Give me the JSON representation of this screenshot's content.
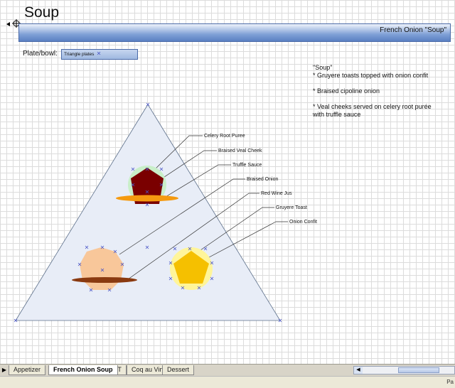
{
  "page": {
    "title": "Soup",
    "banner_title": "French Onion \"Soup\""
  },
  "plate": {
    "label": "Plate/bowl:",
    "value": "Triangle plates"
  },
  "notes": [
    "\"Soup\"",
    "* Gruyere toasts topped with onion confit",
    "",
    "* Braised cipoline onion",
    "",
    "* Veal cheeks served on celery root purée",
    "with truffle sauce"
  ],
  "callouts": [
    "Celery Root Puree",
    "Braised Veal Cheek",
    "Truffle Sauce",
    "Braised Onion",
    "Red Wine Jus",
    "Gruyere Toast",
    "Onion Confit"
  ],
  "colors": {
    "plate_fill": "#e8edf7",
    "celery_root_puree": "#c9efc9",
    "braised_veal_cheek": "#7a0000",
    "truffle_sauce": "#f59a10",
    "braised_onion": "#f8c79a",
    "red_wine_jus": "#8a3a10",
    "gruyere_toast": "#fff59a",
    "onion_confit": "#f5c000",
    "banner": "#6f93cf"
  },
  "sheet_tabs": [
    {
      "label": "Appetizer",
      "active": false
    },
    {
      "label": "French Onion Soup",
      "active": true
    },
    {
      "label": "BLT",
      "active": false
    },
    {
      "label": "Coq au Vin",
      "active": false
    },
    {
      "label": "Dessert",
      "active": false
    }
  ],
  "status": {
    "text": "Pa"
  }
}
